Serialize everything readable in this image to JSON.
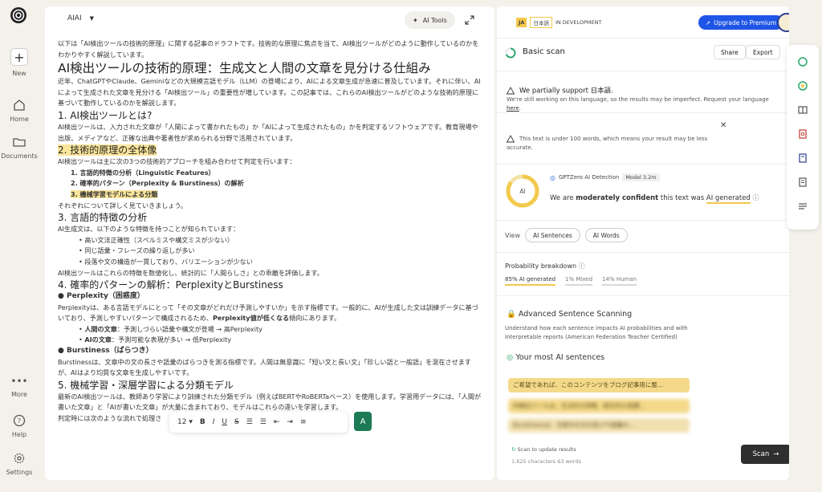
{
  "rail": {
    "new_label": "New",
    "home_label": "Home",
    "documents_label": "Documents",
    "more_label": "More",
    "help_label": "Help",
    "settings_label": "Settings"
  },
  "editor": {
    "model": "AIAI",
    "ai_tools": "AI Tools",
    "intro": "以下は「AI検出ツールの技術的原理」に関する記事のドラフトです。技術的な原理に焦点を当て、AI検出ツールがどのように動作しているのかをわかりやすく解説しています。",
    "title": "AI検出ツールの技術的原理：生成文と人間の文章を見分ける仕組み",
    "p1": "近年、ChatGPTやClaude、Geminiなどの大規模言語モデル（LLM）の登場により、AIによる文章生成が急速に普及しています。それに伴い、AIによって生成された文章を見分ける「AI検出ツール」の重要性が増しています。この記事では、これらのAI検出ツールがどのような技術的原理に基づいて動作しているのかを解説します。",
    "h_s1": "1. AI検出ツールとは?",
    "p_s1": "AI検出ツールは、入力された文章が「人間によって書かれたもの」か「AIによって生成されたもの」かを判定するソフトウェアです。教育現場や出版、メディアなど、正確な出典や著者性が求められる分野で活用されています。",
    "h_s2": "2. 技術的原理の全体像",
    "p_s2": "AI検出ツールは主に次の3つの技術的アプローチを組み合わせて判定を行います：",
    "ol": [
      "1. 言語的特徴の分析（Linguistic Features）",
      "2. 確率的パターン（Perplexity & Burstiness）の解析",
      "3. 機械学習モデルによる分類"
    ],
    "p_s2b": "それぞれについて詳しく見ていきましょう。",
    "h_s3": "3. 言語的特徴の分析",
    "p_s3": "AI生成文は、以下のような特徴を持つことが知られています：",
    "ul_s3": [
      "高い文法正確性（スペルミスや構文ミスが少ない）",
      "同じ語彙・フレーズの繰り返しが多い",
      "段落や文の構造が一貫しており、バリエーションが少ない"
    ],
    "p_s3b": "AI検出ツールはこれらの特徴を数値化し、統計的に「人間らしさ」との乖離を評価します。",
    "h_s4": "4. 確率的パターンの解析：PerplexityとBurstiness",
    "perp_head": "● Perplexity（困惑度）",
    "perp_a": "Perplexityは、ある言語モデルにとって「その文章がどれだけ予測しやすいか」を示す指標です。一般的に、AIが生成した文は訓練データに基づいており、予測しやすいパターンで構成されるため、",
    "perp_b": "Perplexity値が低くなる",
    "perp_c": "傾向にあります。",
    "ul_s4": [
      [
        "人間の文章",
        "：予測しづらい語彙や構文が登場 → 高Perplexity"
      ],
      [
        "AIの文章",
        "：予測可能な表現が多い → 低Perplexity"
      ]
    ],
    "burst_head": "● Burstiness（ばらつき）",
    "burst": "Burstinessは、文章中の文の長さや語彙のばらつきを測る指標です。人間は無意識に「短い文と長い文」「珍しい語と一般語」を混在させますが、AIはより均質な文章を生成しやすいです。",
    "h_s5": "5. 機械学習・深層学習による分類モデル",
    "p_s5": "最新のAI検出ツールは、教師あり学習により訓練された分類モデル（例えばBERTやRoBERTaベース）を使用します。学習用データには、「人間が書いた文章」と「AIが書いた文章」が大量に含まれており、モデルはこれらの違いを学習します。",
    "p_s5b": "判定時には次のような流れで処理さ",
    "font_size": "12"
  },
  "panel": {
    "lang_code": "JA",
    "lang_name": "日本語",
    "status": "IN DEVELOPMENT",
    "upgrade": "Upgrade to Premium",
    "scan_title": "Basic scan",
    "share": "Share",
    "export": "Export",
    "warn1_title": "We partially support 日本語.",
    "warn1_body": "We're still working on this language, so the results may be imperfect. Request your language",
    "warn1_link": "here",
    "warn2": "This text is under 100 words, which means your result may be less accurate.",
    "gauge_label": "AI",
    "detector": "GPTZero AI Detection",
    "model_badge": "Model 3.2m",
    "verdict_a": "We are ",
    "verdict_b": "moderately confident",
    "verdict_c": " this text was ",
    "verdict_d": "AI generated",
    "view_label": "View",
    "view_sentences": "AI Sentences",
    "view_words": "AI Words",
    "prob_title": "Probability breakdown",
    "prob_ai": "85% AI generated",
    "prob_mixed": "1% Mixed",
    "prob_human": "14% Human",
    "adv_title": "Advanced Sentence Scanning",
    "adv_desc": "Understand how each sentence impacts AI probabilities and with interpretable reports (American Federation Teacher Certified)",
    "most_title": "Your most AI sentences",
    "sentences": [
      "ご希望であれば、このコンテンツをブログ記事用に整…",
      "AI検出ツールは、文法的な特徴、統計的な指標…",
      "Burstinessは、文章中の文の長さや語彙の…"
    ],
    "scan_update": "Scan to update results",
    "chars": "1,625 characters 63 words",
    "scan_btn": "Scan"
  },
  "colors": {
    "accent_yellow": "#f2c94c",
    "brand_blue": "#1f55e6",
    "dark": "#2f2f2f"
  }
}
